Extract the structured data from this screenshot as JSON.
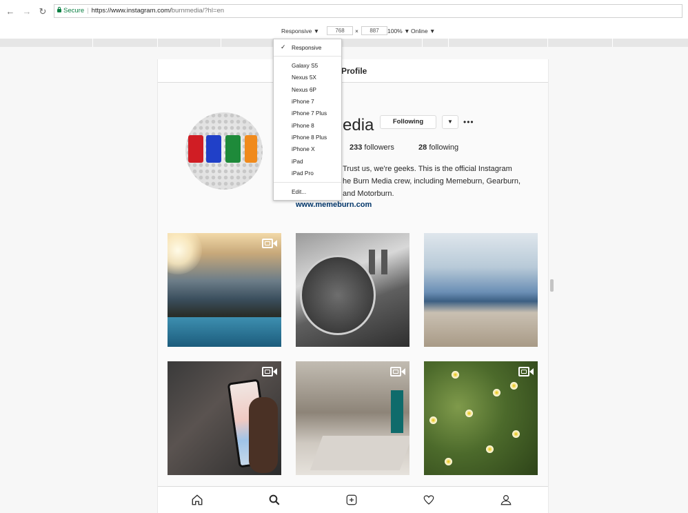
{
  "browser": {
    "secure_label": "Secure",
    "url_host": "https://www.instagram.com/",
    "url_path": "burnmedia/?hl=en"
  },
  "device_toolbar": {
    "device_label": "Responsive",
    "width": "768",
    "times": "×",
    "height": "887",
    "zoom": "100%",
    "network": "Online"
  },
  "device_menu": {
    "selected": "Responsive",
    "items": [
      "Galaxy S5",
      "Nexus 5X",
      "Nexus 6P",
      "iPhone 7",
      "iPhone 7 Plus",
      "iPhone 8",
      "iPhone 8 Plus",
      "iPhone X",
      "iPad",
      "iPad Pro"
    ],
    "edit_label": "Edit..."
  },
  "profile": {
    "header_title": "Profile",
    "username_visible": "edia",
    "follow_button": "Following",
    "followers": "233",
    "followers_label": "followers",
    "following": "28",
    "following_label": "following",
    "bio_lines": [
      "Trust us, we're geeks. This is the official Instagram",
      "he Burn Media crew, including Memeburn, Gearburn,",
      "and Motorburn."
    ],
    "website": "www.memeburn.com"
  },
  "colors": {
    "link": "#003569",
    "secure": "#0b8043",
    "border": "#dbdbdb"
  },
  "icons": {
    "nav": [
      "home-icon",
      "search-icon",
      "add-post-icon",
      "heart-icon",
      "profile-icon"
    ],
    "video_badge": "video-camera-icon"
  }
}
